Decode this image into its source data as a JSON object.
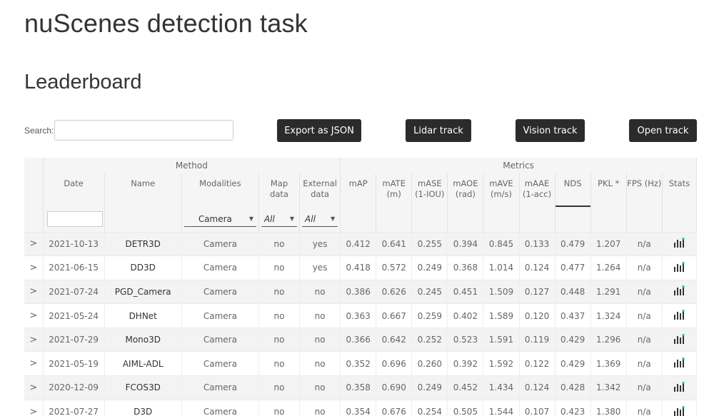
{
  "page": {
    "title": "nuScenes detection task",
    "section": "Leaderboard"
  },
  "search": {
    "label": "Search:",
    "value": "",
    "placeholder": ""
  },
  "buttons": {
    "export": "Export as JSON",
    "lidar": "Lidar track",
    "vision": "Vision track",
    "open": "Open track"
  },
  "groups": {
    "method": "Method",
    "metrics": "Metrics"
  },
  "columns": {
    "date": "Date",
    "name": "Name",
    "modalities": "Modalities",
    "map1": "Map",
    "map2": "data",
    "ext1": "External",
    "ext2": "data",
    "map_label": "mAP",
    "mate1": "mATE",
    "mate2": "(m)",
    "mase1": "mASE",
    "mase2": "(1-IOU)",
    "maoe1": "mAOE",
    "maoe2": "(rad)",
    "mave1": "mAVE",
    "mave2": "(m/s)",
    "maae1": "mAAE",
    "maae2": "(1-acc)",
    "nds": "NDS",
    "pkl": "PKL *",
    "fps": "FPS (Hz)",
    "stats": "Stats"
  },
  "filters": {
    "modality": "Camera",
    "map": "All",
    "external": "All"
  },
  "rows": [
    {
      "expander": ">",
      "date": "2021-10-13",
      "name": "DETR3D",
      "modalities": "Camera",
      "map": "no",
      "ext": "yes",
      "mAP": "0.412",
      "mATE": "0.641",
      "mASE": "0.255",
      "mAOE": "0.394",
      "mAVE": "0.845",
      "mAAE": "0.133",
      "NDS": "0.479",
      "PKL": "1.207",
      "FPS": "n/a"
    },
    {
      "expander": ">",
      "date": "2021-06-15",
      "name": "DD3D",
      "modalities": "Camera",
      "map": "no",
      "ext": "yes",
      "mAP": "0.418",
      "mATE": "0.572",
      "mASE": "0.249",
      "mAOE": "0.368",
      "mAVE": "1.014",
      "mAAE": "0.124",
      "NDS": "0.477",
      "PKL": "1.264",
      "FPS": "n/a"
    },
    {
      "expander": ">",
      "date": "2021-07-24",
      "name": "PGD_Camera",
      "modalities": "Camera",
      "map": "no",
      "ext": "no",
      "mAP": "0.386",
      "mATE": "0.626",
      "mASE": "0.245",
      "mAOE": "0.451",
      "mAVE": "1.509",
      "mAAE": "0.127",
      "NDS": "0.448",
      "PKL": "1.291",
      "FPS": "n/a"
    },
    {
      "expander": ">",
      "date": "2021-05-24",
      "name": "DHNet",
      "modalities": "Camera",
      "map": "no",
      "ext": "no",
      "mAP": "0.363",
      "mATE": "0.667",
      "mASE": "0.259",
      "mAOE": "0.402",
      "mAVE": "1.589",
      "mAAE": "0.120",
      "NDS": "0.437",
      "PKL": "1.324",
      "FPS": "n/a"
    },
    {
      "expander": ">",
      "date": "2021-07-29",
      "name": "Mono3D",
      "modalities": "Camera",
      "map": "no",
      "ext": "no",
      "mAP": "0.366",
      "mATE": "0.642",
      "mASE": "0.252",
      "mAOE": "0.523",
      "mAVE": "1.591",
      "mAAE": "0.119",
      "NDS": "0.429",
      "PKL": "1.296",
      "FPS": "n/a"
    },
    {
      "expander": ">",
      "date": "2021-05-19",
      "name": "AIML-ADL",
      "modalities": "Camera",
      "map": "no",
      "ext": "no",
      "mAP": "0.352",
      "mATE": "0.696",
      "mASE": "0.260",
      "mAOE": "0.392",
      "mAVE": "1.592",
      "mAAE": "0.122",
      "NDS": "0.429",
      "PKL": "1.369",
      "FPS": "n/a"
    },
    {
      "expander": ">",
      "date": "2020-12-09",
      "name": "FCOS3D",
      "modalities": "Camera",
      "map": "no",
      "ext": "no",
      "mAP": "0.358",
      "mATE": "0.690",
      "mASE": "0.249",
      "mAOE": "0.452",
      "mAVE": "1.434",
      "mAAE": "0.124",
      "NDS": "0.428",
      "PKL": "1.342",
      "FPS": "n/a"
    },
    {
      "expander": ">",
      "date": "2021-07-27",
      "name": "D3D",
      "modalities": "Camera",
      "map": "no",
      "ext": "no",
      "mAP": "0.354",
      "mATE": "0.676",
      "mASE": "0.254",
      "mAOE": "0.505",
      "mAVE": "1.544",
      "mAAE": "0.107",
      "NDS": "0.423",
      "PKL": "1.380",
      "FPS": "n/a"
    }
  ],
  "stats_icon": "bar-chart-icon",
  "colors": {
    "button_bg": "#2b2b2b",
    "header_bg": "#f5f5f5",
    "row_alt": "#f3f3f3",
    "icon_accent": "#2ab3c0"
  }
}
